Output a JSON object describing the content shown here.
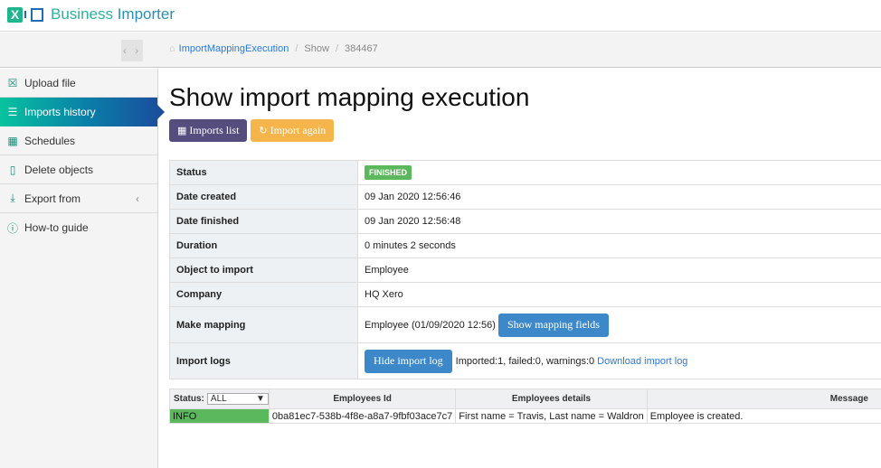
{
  "app": {
    "title_part1": "Business ",
    "title_part2": "Importer",
    "logo_letter": "X"
  },
  "breadcrumb": {
    "items": [
      "ImportMappingExecution",
      "Show",
      "384467"
    ]
  },
  "sidebar": {
    "items": [
      {
        "label": "Upload file",
        "icon": "excel-file-icon",
        "glyph": "☒"
      },
      {
        "label": "Imports history",
        "icon": "list-icon",
        "glyph": "☰",
        "active": true
      },
      {
        "label": "Schedules",
        "icon": "calendar-icon",
        "glyph": "▦"
      },
      {
        "label": "Delete objects",
        "icon": "trash-icon",
        "glyph": "▯"
      },
      {
        "label": "Export from",
        "icon": "download-icon",
        "glyph": "⤓",
        "chevron": "‹"
      },
      {
        "label": "How-to guide",
        "icon": "info-icon",
        "glyph": "ⓘ"
      }
    ]
  },
  "page": {
    "title": "Show import mapping execution",
    "buttons": {
      "imports_list": "Imports list",
      "import_again": "Import again"
    }
  },
  "details": {
    "status_label": "Status",
    "status_value": "FINISHED",
    "date_created_label": "Date created",
    "date_created": "09 Jan 2020 12:56:46",
    "date_finished_label": "Date finished",
    "date_finished": "09 Jan 2020 12:56:48",
    "duration_label": "Duration",
    "duration": "0 minutes 2 seconds",
    "object_label": "Object to import",
    "object": "Employee",
    "company_label": "Company",
    "company": "HQ Xero",
    "mapping_label": "Make mapping",
    "mapping": "Employee (01/09/2020 12:56)",
    "mapping_button": "Show mapping fields",
    "logs_label": "Import logs",
    "logs_button": "Hide import log",
    "logs_summary": "Imported:1, failed:0, warnings:0",
    "logs_download": "Download import log"
  },
  "log_table": {
    "status_filter_label": "Status:",
    "status_filter_value": "ALL",
    "columns": [
      "Employees Id",
      "Employees details",
      "Message"
    ],
    "rows": [
      {
        "status": "INFO",
        "id": "0ba81ec7-538b-4f8e-a8a7-9fbf03ace7c7",
        "details": "First name = Travis, Last name = Waldron",
        "message": "Employee is created."
      }
    ]
  },
  "colors": {
    "accent": "#1fb58f",
    "link": "#2a7ad9",
    "success": "#5cb85c",
    "purple": "#554d7d",
    "orange": "#f6b54a",
    "blue": "#3d88c9"
  }
}
